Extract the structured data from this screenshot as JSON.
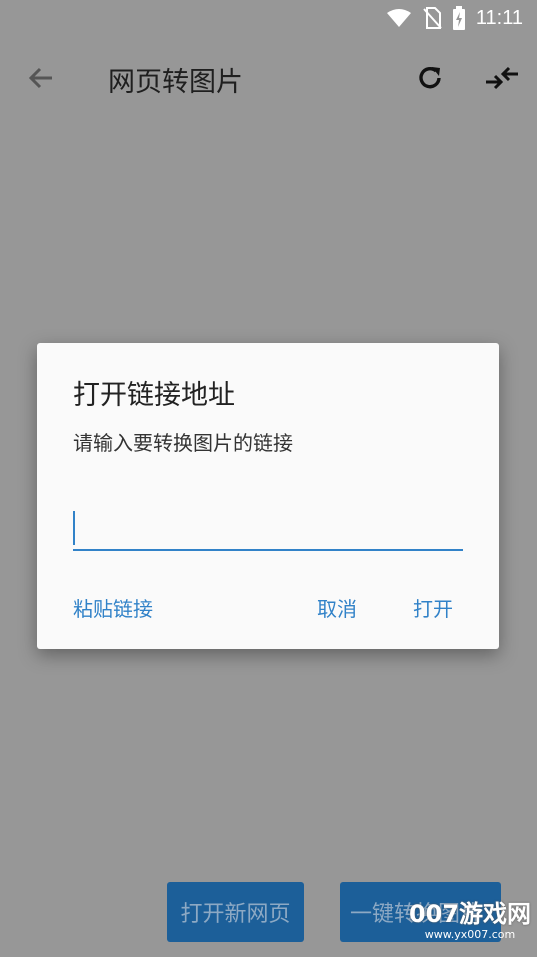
{
  "status_bar": {
    "time": "11:11"
  },
  "toolbar": {
    "title": "网页转图片"
  },
  "bottom": {
    "open_new_page": "打开新网页",
    "one_click_convert": "一键转换图片"
  },
  "watermark": {
    "name": "007游戏网",
    "url": "www.yx007.com"
  },
  "dialog": {
    "title": "打开链接地址",
    "message": "请输入要转换图片的链接",
    "input_value": "",
    "paste_label": "粘贴链接",
    "cancel_label": "取消",
    "open_label": "打开"
  },
  "colors": {
    "accent": "#3182c8",
    "overlay": "#979797",
    "button_bg": "#1c5f99"
  }
}
